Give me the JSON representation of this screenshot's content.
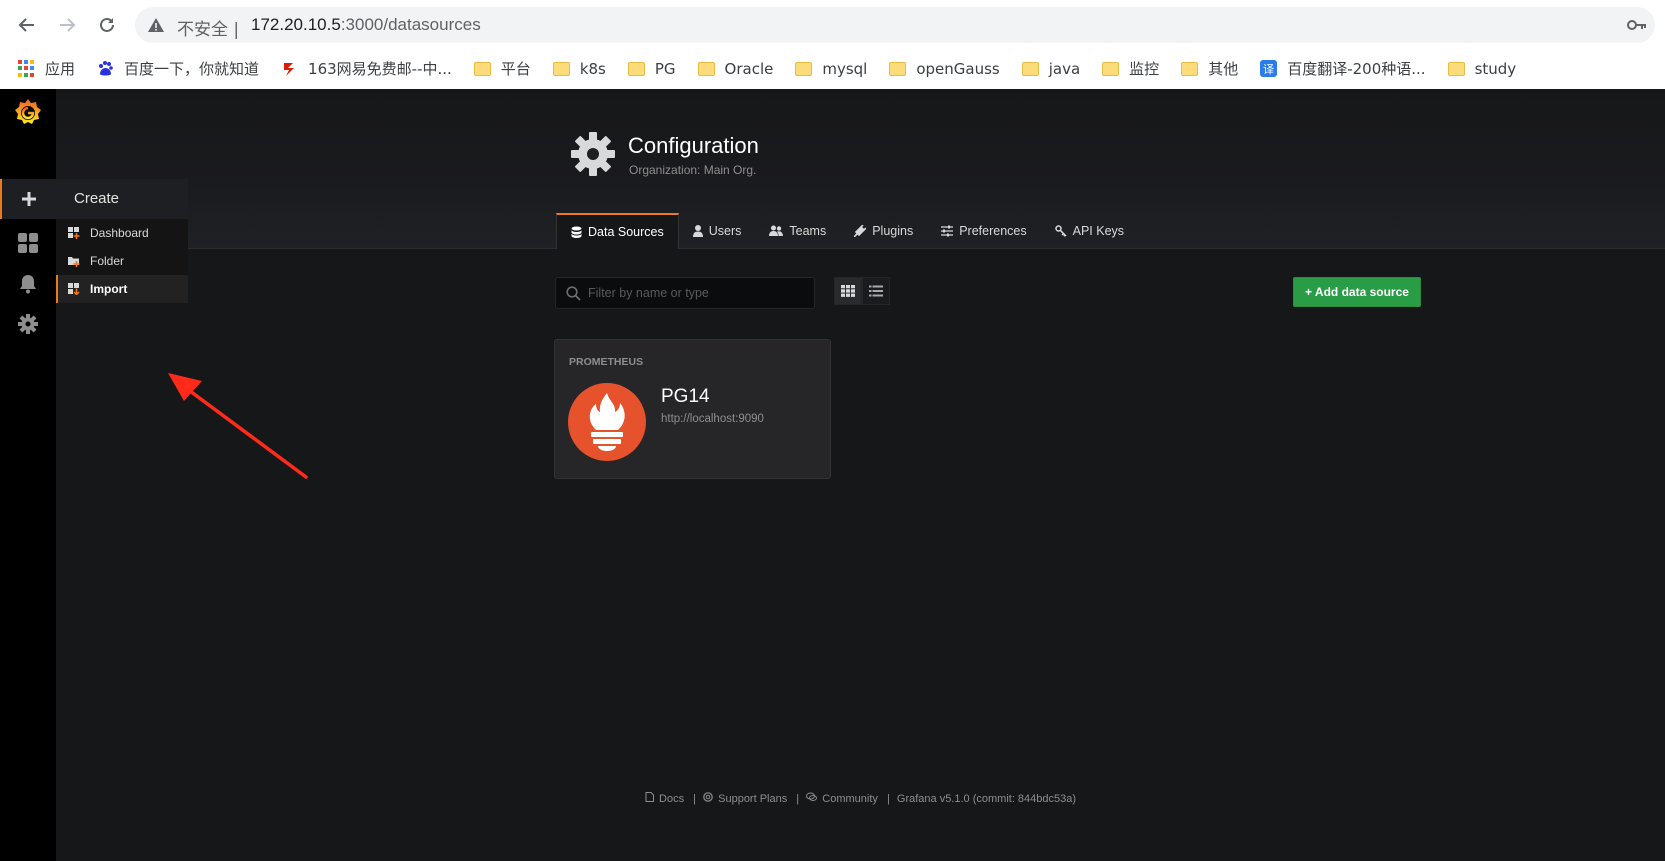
{
  "browser": {
    "security_label": "不安全 |",
    "url_host": "172.20.10.5",
    "url_path": ":3000/datasources",
    "bookmarks": [
      {
        "label": "应用",
        "icon": "apps-icon"
      },
      {
        "label": "百度一下，你就知道",
        "icon": "baidu-icon"
      },
      {
        "label": "163网易免费邮--中...",
        "icon": "netease-icon"
      },
      {
        "label": "平台",
        "icon": "folder-icon"
      },
      {
        "label": "k8s",
        "icon": "folder-icon"
      },
      {
        "label": "PG",
        "icon": "folder-icon"
      },
      {
        "label": "Oracle",
        "icon": "folder-icon"
      },
      {
        "label": "mysql",
        "icon": "folder-icon"
      },
      {
        "label": "openGauss",
        "icon": "folder-icon"
      },
      {
        "label": "java",
        "icon": "folder-icon"
      },
      {
        "label": "监控",
        "icon": "folder-icon"
      },
      {
        "label": "其他",
        "icon": "folder-icon"
      },
      {
        "label": "百度翻译-200种语...",
        "icon": "translate-icon"
      },
      {
        "label": "study",
        "icon": "folder-icon"
      }
    ]
  },
  "create_menu": {
    "title": "Create",
    "items": [
      {
        "label": "Dashboard"
      },
      {
        "label": "Folder"
      },
      {
        "label": "Import"
      }
    ]
  },
  "header": {
    "title": "Configuration",
    "subtitle": "Organization: Main Org."
  },
  "tabs": [
    {
      "label": "Data Sources"
    },
    {
      "label": "Users"
    },
    {
      "label": "Teams"
    },
    {
      "label": "Plugins"
    },
    {
      "label": "Preferences"
    },
    {
      "label": "API Keys"
    }
  ],
  "toolbar": {
    "filter_placeholder": "Filter by name or type",
    "add_button": "+ Add data source"
  },
  "datasource": {
    "type": "PROMETHEUS",
    "name": "PG14",
    "url": "http://localhost:9090"
  },
  "footer": {
    "docs": "Docs",
    "support": "Support Plans",
    "community": "Community",
    "version": "Grafana v5.1.0 (commit: 844bdc53a)"
  },
  "colors": {
    "accent": "#eb7b18",
    "success": "#299c46",
    "prometheus": "#e6522c",
    "annotation": "#ff2a1a"
  }
}
